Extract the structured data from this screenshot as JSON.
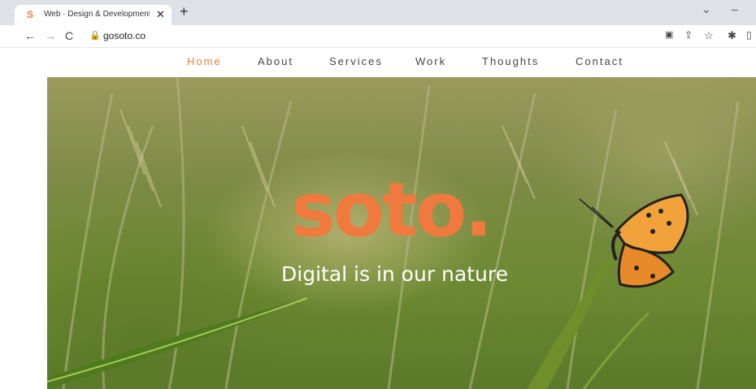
{
  "browser": {
    "tab_favicon": "S",
    "tab_title": "Web · Design & Development · S",
    "tab_close": "✕",
    "new_tab": "+",
    "url": "gosoto.co"
  },
  "nav": {
    "items": [
      "Home",
      "About",
      "Services",
      "Work",
      "Thoughts",
      "Contact"
    ],
    "active": "Home"
  },
  "hero": {
    "logo": "soto.",
    "tagline": "Digital is in our nature"
  },
  "colors": {
    "accent": "#ec7c3d",
    "logo": "#f07a3e"
  },
  "icons": [
    "back-icon",
    "forward-icon",
    "reload-icon",
    "lock-icon",
    "translate-icon",
    "share-icon",
    "bookmark-star-icon",
    "extensions-icon",
    "sidepanel-icon",
    "chevron-down-icon",
    "minimize-icon"
  ]
}
